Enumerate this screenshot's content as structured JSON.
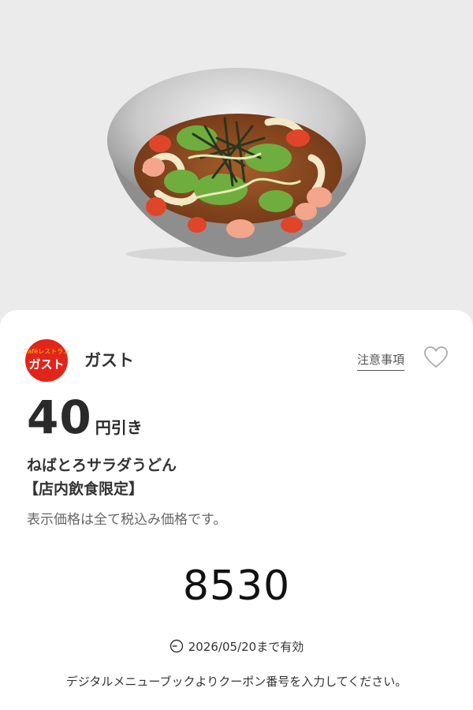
{
  "brand": {
    "name": "ガスト",
    "logo_text_top": "Caféレストラン",
    "logo_text_main": "ガスト"
  },
  "links": {
    "notes_label": "注意事項"
  },
  "coupon": {
    "discount_amount": "40",
    "discount_unit": "円引き",
    "item_name": "ねばとろサラダうどん",
    "item_note": "【店内飲食限定】",
    "tax_note": "表示価格は全て税込み価格です。",
    "code": "8530",
    "validity": "2026/05/20まで有効",
    "instruction": "デジタルメニューブックよりクーポン番号を入力してください。"
  },
  "colors": {
    "brand_red": "#e1251b",
    "logo_yellow": "#f3c400"
  },
  "icons": [
    "heart-outline-icon",
    "clock-icon"
  ]
}
